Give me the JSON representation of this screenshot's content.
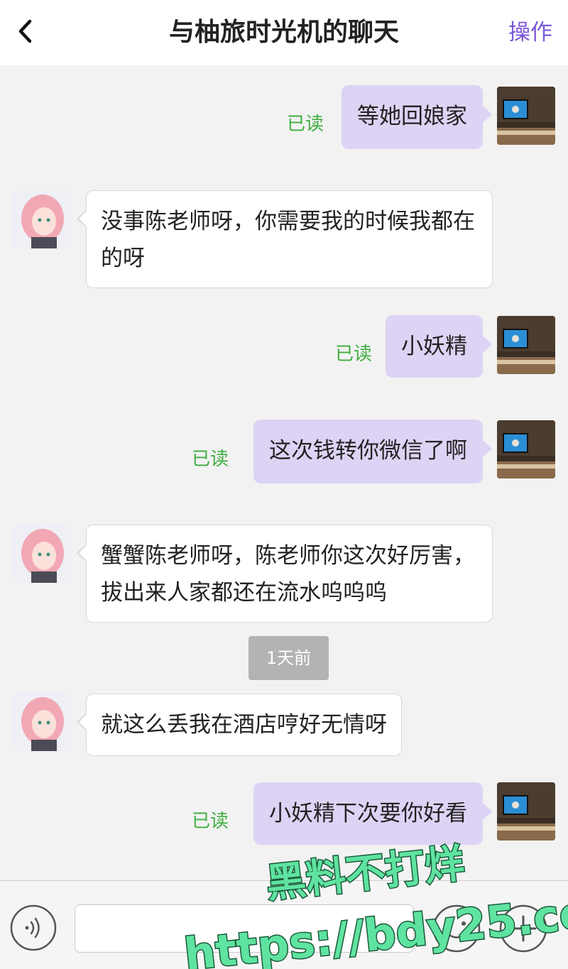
{
  "header": {
    "title": "与柚旅时光机的聊天",
    "action_label": "操作"
  },
  "messages": [
    {
      "side": "mine",
      "text": "等她回娘家",
      "status": "已读"
    },
    {
      "side": "theirs",
      "text": "没事陈老师呀，你需要我的时候我都在的呀"
    },
    {
      "side": "mine",
      "text": "小妖精",
      "status": "已读"
    },
    {
      "side": "mine",
      "text": "这次钱转你微信了啊",
      "status": "已读"
    },
    {
      "side": "theirs",
      "text": "蟹蟹陈老师呀，陈老师你这次好厉害，拔出来人家都还在流水呜呜呜"
    },
    {
      "side": "theirs",
      "text": "就这么丢我在酒店哼好无情呀"
    },
    {
      "side": "mine",
      "text": "小妖精下次要你好看",
      "status": "已读"
    }
  ],
  "time_divider": "1天前",
  "input_bar": {
    "text_value": "",
    "icons": [
      "voice-icon",
      "emoji-icon",
      "plus-icon"
    ]
  },
  "watermark": {
    "line1": "黑料不打烊",
    "line2": "https://bdy25.co"
  },
  "colors": {
    "accent": "#7b58d8",
    "my_bubble": "#ddd3f4",
    "read_status": "#3fae3f",
    "watermark": "#5fe3a0"
  }
}
